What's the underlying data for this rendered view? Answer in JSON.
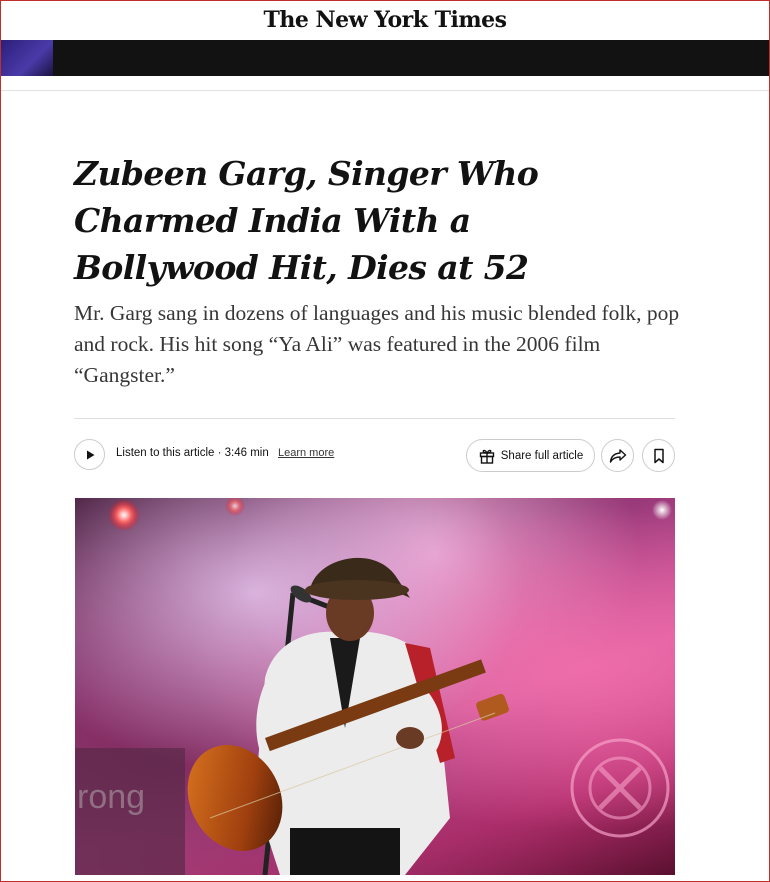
{
  "masthead": {
    "logo": "The New York Times"
  },
  "article": {
    "headline": "Zubeen Garg, Singer Who Charmed India With a Bollywood Hit, Dies at 52",
    "summary": "Mr. Garg sang in dozens of languages and his music blended folk, pop and rock. His hit song “Ya Ali” was featured in the 2006 film “Gangster.”"
  },
  "toolbar": {
    "listen_label": "Listen to this article · 3:46 min",
    "learn_more": "Learn more",
    "share_label": "Share full article",
    "icons": [
      "play-icon",
      "gift-icon",
      "share-arrow-icon",
      "bookmark-icon"
    ]
  },
  "photo": {
    "banner_text": "rong"
  },
  "colors": {
    "text": "#121212",
    "summary": "#363636",
    "ad_bar": "#121212",
    "frame": "#c0302b"
  }
}
